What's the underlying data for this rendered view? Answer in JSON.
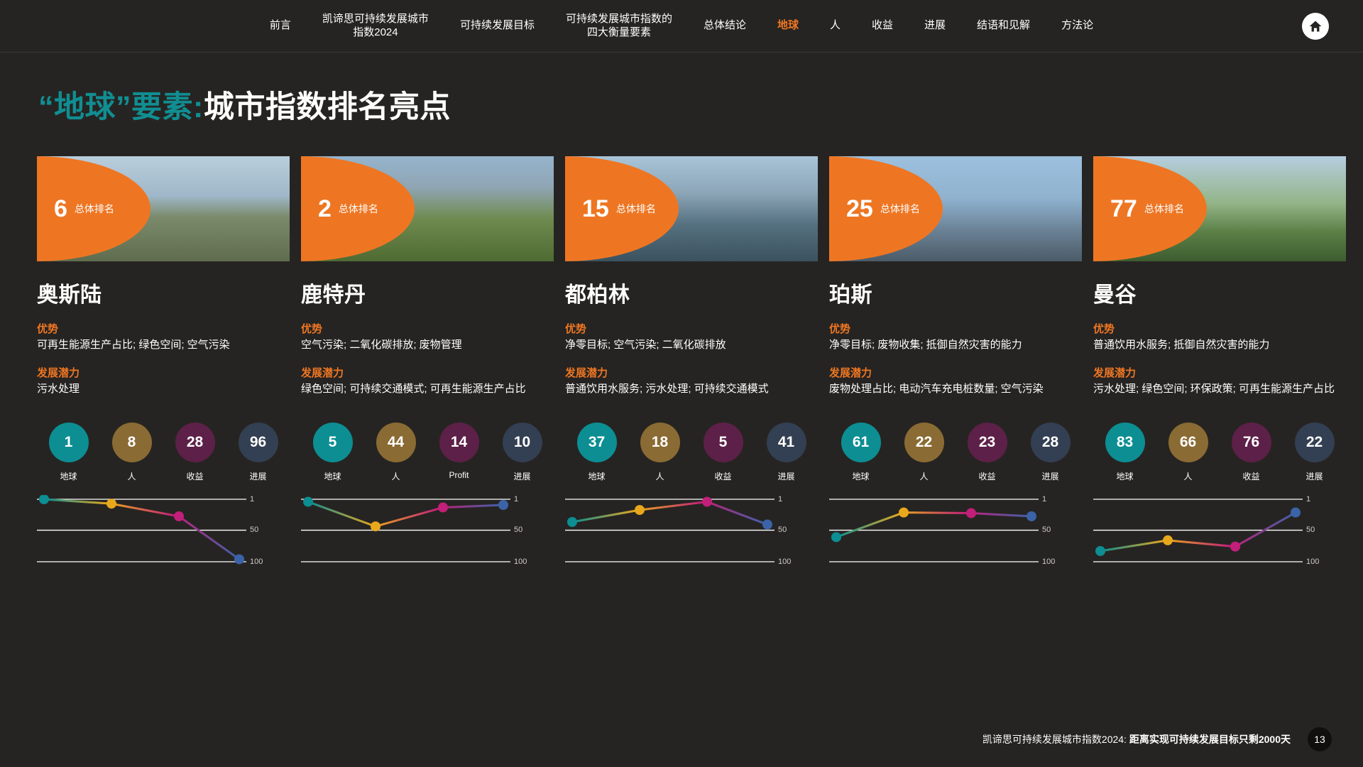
{
  "nav": {
    "items": [
      {
        "label": "前言",
        "active": false
      },
      {
        "label": "凯谛思可持续发展城市\n指数2024",
        "active": false
      },
      {
        "label": "可持续发展目标",
        "active": false
      },
      {
        "label": "可持续发展城市指数的\n四大衡量要素",
        "active": false
      },
      {
        "label": "总体结论",
        "active": false
      },
      {
        "label": "地球",
        "active": true
      },
      {
        "label": "人",
        "active": false
      },
      {
        "label": "收益",
        "active": false
      },
      {
        "label": "进展",
        "active": false
      },
      {
        "label": "结语和见解",
        "active": false
      },
      {
        "label": "方法论",
        "active": false
      }
    ],
    "home_icon": "home-icon"
  },
  "title": {
    "highlight": "“地球”要素:",
    "rest": "城市指数排名亮点"
  },
  "labels": {
    "rank_caption": "总体排名",
    "strengths_head": "优势",
    "potential_head": "发展潜力"
  },
  "colors": {
    "accent_orange": "#ee7623",
    "accent_teal": "#108e92",
    "pillar_planet": "#0c8e93",
    "pillar_people": "#8a6b33",
    "pillar_profit": "#5d2048",
    "pillar_progress": "#333f52",
    "background": "#262422"
  },
  "chart_data": [
    {
      "type": "line",
      "title": "奥斯陆",
      "categories": [
        "地球",
        "人",
        "收益",
        "进展"
      ],
      "values": [
        1,
        8,
        28,
        96
      ],
      "ylabel": "",
      "ylim": [
        1,
        100
      ],
      "yticks": [
        1,
        50,
        100
      ],
      "inverted_y": true,
      "grid": true,
      "legend": "none"
    },
    {
      "type": "line",
      "title": "鹿特丹",
      "categories": [
        "地球",
        "人",
        "Profit",
        "进展"
      ],
      "values": [
        5,
        44,
        14,
        10
      ],
      "ylabel": "",
      "ylim": [
        1,
        100
      ],
      "yticks": [
        1,
        50,
        100
      ],
      "inverted_y": true,
      "grid": true,
      "legend": "none"
    },
    {
      "type": "line",
      "title": "都柏林",
      "categories": [
        "地球",
        "人",
        "收益",
        "进展"
      ],
      "values": [
        37,
        18,
        5,
        41
      ],
      "ylabel": "",
      "ylim": [
        1,
        100
      ],
      "yticks": [
        1,
        50,
        100
      ],
      "inverted_y": true,
      "grid": true,
      "legend": "none"
    },
    {
      "type": "line",
      "title": "珀斯",
      "categories": [
        "地球",
        "人",
        "收益",
        "进展"
      ],
      "values": [
        61,
        22,
        23,
        28
      ],
      "ylabel": "",
      "ylim": [
        1,
        100
      ],
      "yticks": [
        1,
        50,
        100
      ],
      "inverted_y": true,
      "grid": true,
      "legend": "none"
    },
    {
      "type": "line",
      "title": "曼谷",
      "categories": [
        "地球",
        "人",
        "收益",
        "进展"
      ],
      "values": [
        83,
        66,
        76,
        22
      ],
      "ylabel": "",
      "ylim": [
        1,
        100
      ],
      "yticks": [
        1,
        50,
        100
      ],
      "inverted_y": true,
      "grid": true,
      "legend": "none"
    }
  ],
  "cards": [
    {
      "rank": "6",
      "city": "奥斯陆",
      "strengths": "可再生能源生产占比; 绿色空间; 空气污染",
      "potential": "污水处理",
      "pillars": [
        {
          "value": "1",
          "label": "地球"
        },
        {
          "value": "8",
          "label": "人"
        },
        {
          "value": "28",
          "label": "收益"
        },
        {
          "value": "96",
          "label": "进展"
        }
      ]
    },
    {
      "rank": "2",
      "city": "鹿特丹",
      "strengths": "空气污染; 二氧化碳排放; 废物管理",
      "potential": "绿色空间; 可持续交通模式; 可再生能源生产占比",
      "pillars": [
        {
          "value": "5",
          "label": "地球"
        },
        {
          "value": "44",
          "label": "人"
        },
        {
          "value": "14",
          "label": "Profit"
        },
        {
          "value": "10",
          "label": "进展"
        }
      ]
    },
    {
      "rank": "15",
      "city": "都柏林",
      "strengths": "净零目标; 空气污染; 二氧化碳排放",
      "potential": "普通饮用水服务; 污水处理; 可持续交通模式",
      "pillars": [
        {
          "value": "37",
          "label": "地球"
        },
        {
          "value": "18",
          "label": "人"
        },
        {
          "value": "5",
          "label": "收益"
        },
        {
          "value": "41",
          "label": "进展"
        }
      ]
    },
    {
      "rank": "25",
      "city": "珀斯",
      "strengths": "净零目标; 废物收集; 抵御自然灾害的能力",
      "potential": "废物处理占比; 电动汽车充电桩数量; 空气污染",
      "pillars": [
        {
          "value": "61",
          "label": "地球"
        },
        {
          "value": "22",
          "label": "人"
        },
        {
          "value": "23",
          "label": "收益"
        },
        {
          "value": "28",
          "label": "进展"
        }
      ]
    },
    {
      "rank": "77",
      "city": "曼谷",
      "strengths": "普通饮用水服务; 抵御自然灾害的能力",
      "potential": "污水处理; 绿色空间; 环保政策; 可再生能源生产占比",
      "pillars": [
        {
          "value": "83",
          "label": "地球"
        },
        {
          "value": "66",
          "label": "人"
        },
        {
          "value": "76",
          "label": "收益"
        },
        {
          "value": "22",
          "label": "进展"
        }
      ]
    }
  ],
  "footer": {
    "text_normal": "凯谛思可持续发展城市指数2024: ",
    "text_bold": "距离实现可持续发展目标只剩2000天",
    "page": "13"
  }
}
